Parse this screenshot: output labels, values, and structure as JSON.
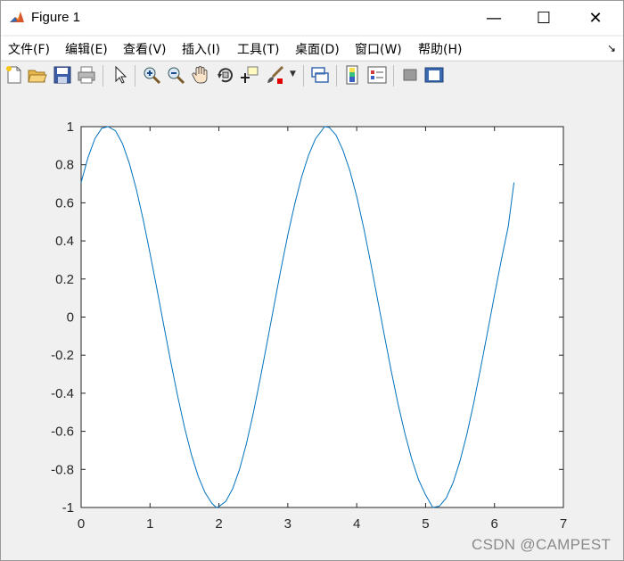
{
  "window": {
    "title": "Figure 1",
    "minimize_glyph": "—",
    "maximize_glyph": "☐",
    "close_glyph": "✕"
  },
  "menu": {
    "items": [
      "文件(F)",
      "编辑(E)",
      "查看(V)",
      "插入(I)",
      "工具(T)",
      "桌面(D)",
      "窗口(W)",
      "帮助(H)"
    ],
    "expand_glyph": "↘"
  },
  "toolbar": {
    "icons": [
      "new-figure-icon",
      "open-icon",
      "save-icon",
      "print-icon",
      "pointer-icon",
      "zoom-in-icon",
      "zoom-out-icon",
      "pan-hand-icon",
      "rotate-3d-icon",
      "data-cursor-icon",
      "brush-icon",
      "link-plot-icon",
      "colorbar-icon",
      "legend-icon",
      "hide-plot-tools-icon",
      "show-plot-tools-icon"
    ]
  },
  "chart_data": {
    "type": "line",
    "x_label_ticks": [
      "0",
      "1",
      "2",
      "3",
      "4",
      "5",
      "6",
      "7"
    ],
    "y_label_ticks": [
      "1",
      "0.8",
      "0.6",
      "0.4",
      "0.2",
      "0",
      "-0.2",
      "-0.4",
      "-0.6",
      "-0.8",
      "-1"
    ],
    "xlim": [
      0,
      7
    ],
    "ylim": [
      -1,
      1
    ],
    "series": [
      {
        "color": "#0072bd",
        "x": [
          0.0,
          0.1,
          0.2,
          0.3,
          0.393,
          0.5,
          0.6,
          0.7,
          0.8,
          0.9,
          1.0,
          1.1,
          1.2,
          1.3,
          1.4,
          1.5,
          1.6,
          1.7,
          1.8,
          1.9,
          1.963,
          2.0,
          2.1,
          2.2,
          2.3,
          2.4,
          2.5,
          2.6,
          2.7,
          2.8,
          2.9,
          3.0,
          3.1,
          3.2,
          3.3,
          3.4,
          3.534,
          3.6,
          3.7,
          3.8,
          3.9,
          4.0,
          4.1,
          4.2,
          4.3,
          4.4,
          4.5,
          4.6,
          4.7,
          4.8,
          4.9,
          5.0,
          5.105,
          5.2,
          5.3,
          5.4,
          5.5,
          5.6,
          5.7,
          5.8,
          5.9,
          6.0,
          6.1,
          6.2,
          6.283
        ],
        "y": [
          0.707,
          0.838,
          0.937,
          0.992,
          1.0,
          0.978,
          0.911,
          0.807,
          0.673,
          0.513,
          0.335,
          0.148,
          -0.044,
          -0.233,
          -0.413,
          -0.578,
          -0.721,
          -0.837,
          -0.923,
          -0.979,
          -1.0,
          -0.995,
          -0.968,
          -0.901,
          -0.799,
          -0.664,
          -0.503,
          -0.323,
          -0.133,
          0.06,
          0.251,
          0.431,
          0.593,
          0.735,
          0.849,
          0.935,
          1.0,
          0.996,
          0.956,
          0.876,
          0.77,
          0.634,
          0.471,
          0.29,
          0.098,
          -0.093,
          -0.281,
          -0.456,
          -0.612,
          -0.747,
          -0.856,
          -0.934,
          -1.0,
          -0.993,
          -0.95,
          -0.869,
          -0.755,
          -0.614,
          -0.449,
          -0.266,
          -0.077,
          0.115,
          0.301,
          0.476,
          0.707
        ]
      }
    ],
    "grid": false
  },
  "watermark": "CSDN @CAMPEST"
}
